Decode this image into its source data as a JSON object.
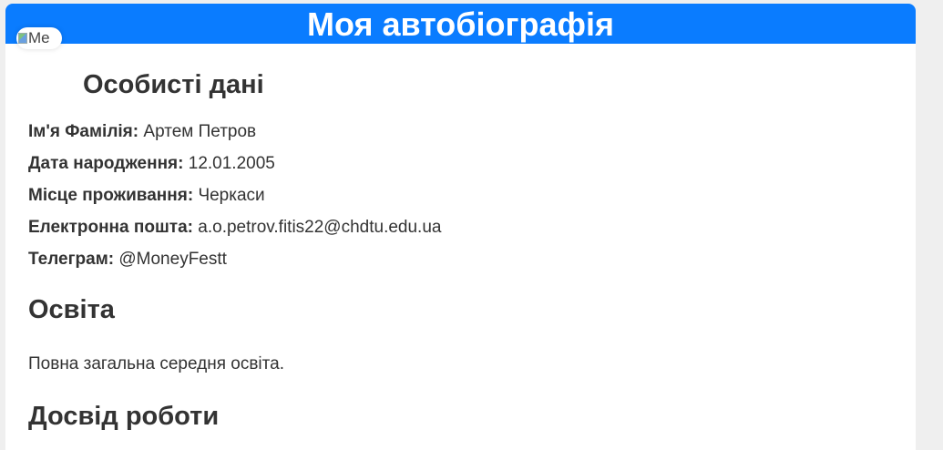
{
  "header": {
    "title": "Моя автобіографія"
  },
  "avatar": {
    "alt_text": "Me",
    "icon": "broken-image-icon"
  },
  "personal": {
    "title": "Особисті дані",
    "rows": [
      {
        "label": "Ім'я Фамілія:",
        "value": "Артем Петров"
      },
      {
        "label": "Дата народження:",
        "value": "12.01.2005"
      },
      {
        "label": "Місце проживання:",
        "value": "Черкаси"
      },
      {
        "label": "Електронна пошта:",
        "value": "a.o.petrov.fitis22@chdtu.edu.ua"
      },
      {
        "label": "Телеграм:",
        "value": "@MoneyFestt"
      }
    ]
  },
  "education": {
    "title": "Освіта",
    "text": "Повна загальна середня освіта."
  },
  "work": {
    "title": "Досвід роботи"
  },
  "colors": {
    "header_bg": "#0a7cff",
    "page_bg": "#efefef",
    "text": "#333333"
  }
}
